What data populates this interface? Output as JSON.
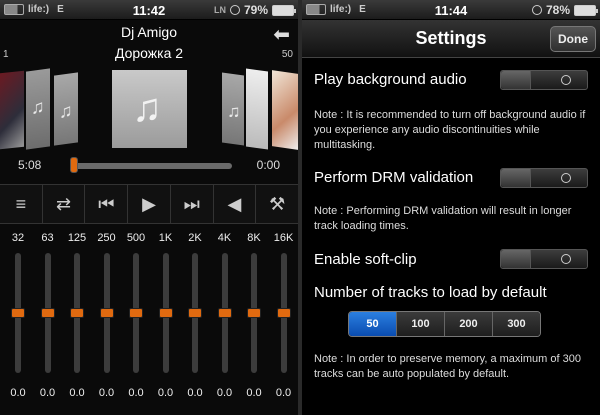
{
  "left_screen": {
    "status": {
      "carrier": "life:)",
      "network": "E",
      "time": "11:42",
      "ln": "LN",
      "battery": "79%"
    },
    "header": {
      "artist": "Dj Amigo",
      "track": "Дорожка 2",
      "back_icon": "back-arrow-icon",
      "index_start": "1",
      "index_end": "50"
    },
    "playback": {
      "elapsed": "5:08",
      "remaining": "0:00",
      "progress": 0.0
    },
    "controls": [
      {
        "name": "playlist-button",
        "icon": "list-icon",
        "glyph": "≡"
      },
      {
        "name": "shuffle-button",
        "icon": "shuffle-icon",
        "glyph": "⇄"
      },
      {
        "name": "previous-button",
        "icon": "previous-icon",
        "glyph": "⏮"
      },
      {
        "name": "play-button",
        "icon": "play-icon",
        "glyph": "▶"
      },
      {
        "name": "next-button",
        "icon": "next-icon",
        "glyph": "⏭"
      },
      {
        "name": "volume-button",
        "icon": "speaker-icon",
        "glyph": "◀"
      },
      {
        "name": "settings-button",
        "icon": "wrench-icon",
        "glyph": "🔧"
      }
    ],
    "equalizer": {
      "bands": [
        "32",
        "63",
        "125",
        "250",
        "500",
        "1K",
        "2K",
        "4K",
        "8K",
        "16K"
      ],
      "values": [
        "0.0",
        "0.0",
        "0.0",
        "0.0",
        "0.0",
        "0.0",
        "0.0",
        "0.0",
        "0.0",
        "0.0"
      ]
    }
  },
  "right_screen": {
    "status": {
      "carrier": "life:)",
      "network": "E",
      "time": "11:44",
      "battery": "78%"
    },
    "nav": {
      "title": "Settings",
      "done_label": "Done"
    },
    "settings": {
      "background_audio": {
        "label": "Play background audio",
        "on": false
      },
      "background_note": "Note : It is recommended to turn off background audio if you experience any audio discontinuities while multitasking.",
      "drm": {
        "label": "Perform DRM validation",
        "on": false
      },
      "drm_note": "Note : Performing DRM validation will result in longer track loading times.",
      "softclip": {
        "label": "Enable soft-clip",
        "on": false
      },
      "tracks_label": "Number of tracks to load by default",
      "tracks_options": [
        "50",
        "100",
        "200",
        "300"
      ],
      "tracks_selected": "50",
      "tracks_note": "Note : In order to preserve memory, a maximum of 300 tracks can be auto populated by default."
    }
  },
  "colors": {
    "accent_orange": "#e06a10",
    "selected_blue": "#1f6fd6"
  }
}
